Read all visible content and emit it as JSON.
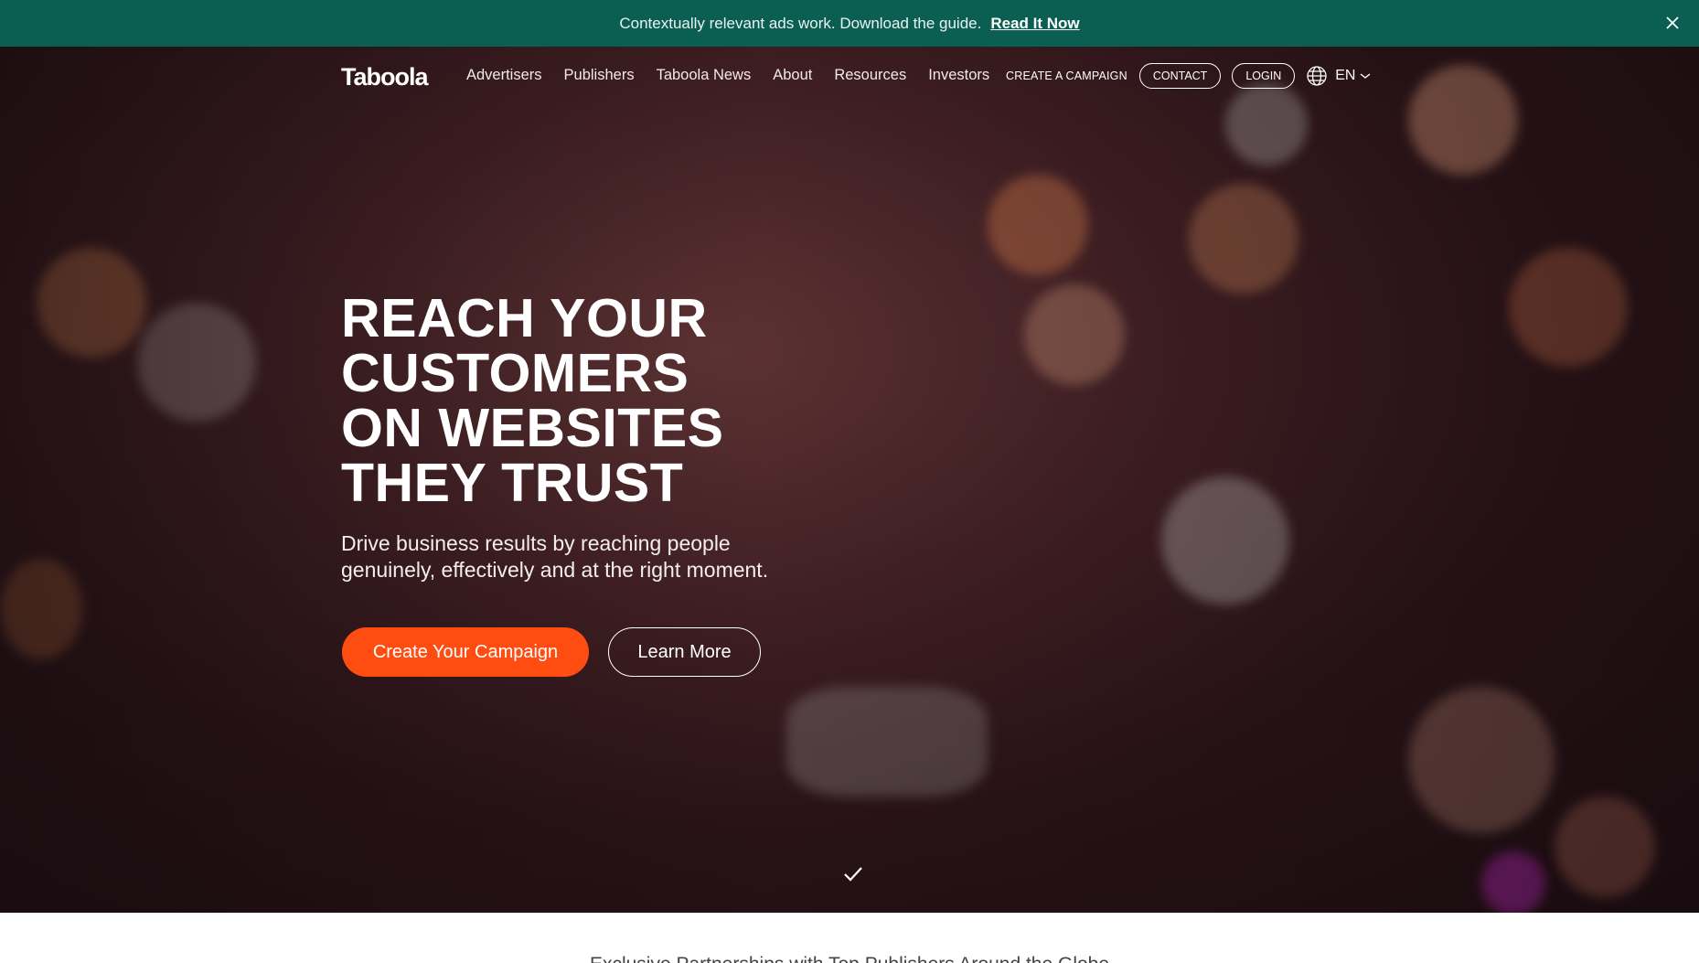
{
  "banner": {
    "message": "Contextually relevant ads work. Download the guide.",
    "link_label": "Read It Now",
    "background": "#0b5e52",
    "close_icon": "close-icon"
  },
  "nav": {
    "logo_text": "Taboola",
    "links": [
      "Advertisers",
      "Publishers",
      "Taboola News",
      "About",
      "Resources",
      "Investors"
    ],
    "create_campaign": "CREATE A CAMPAIGN",
    "contact": "CONTACT",
    "login": "LOGIN",
    "language": "EN",
    "globe_icon": "globe-icon",
    "chevron_icon": "chevron-down-icon"
  },
  "hero": {
    "headline": [
      "REACH YOUR",
      "CUSTOMERS",
      "ON WEBSITES",
      "THEY TRUST"
    ],
    "subtext": [
      "Drive business results by reaching people",
      "genuinely, effectively and at the right moment."
    ],
    "primary_button": "Create Your Campaign",
    "secondary_button": "Learn More",
    "accent_color": "#ff4d11",
    "scroll_icon": "checkmark-icon"
  },
  "below_fold": {
    "partial_text": "Exclusive Partnerships with Top Publishers Around the Globe"
  }
}
